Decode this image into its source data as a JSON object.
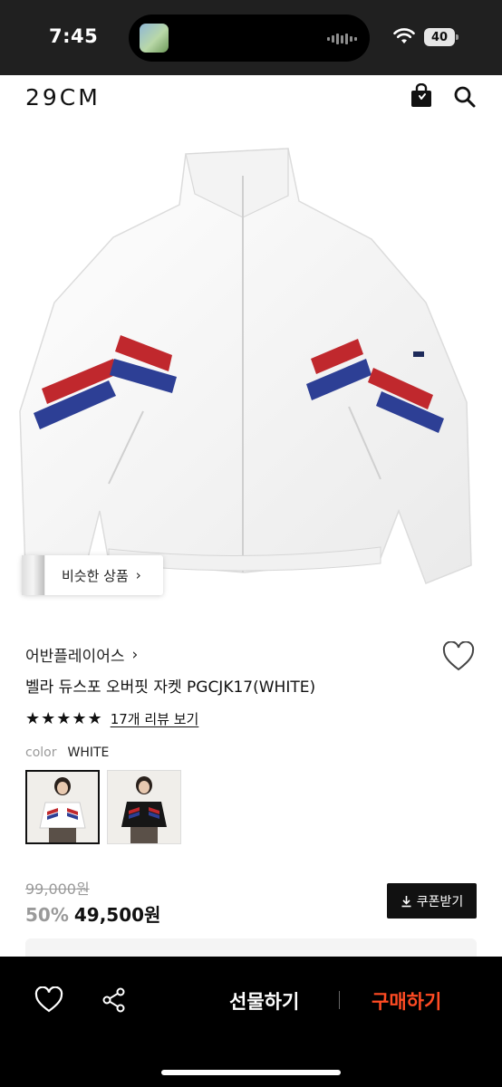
{
  "status_bar": {
    "time": "7:45",
    "battery": "40"
  },
  "header": {
    "logo": "29CM",
    "icons": [
      "bag-icon",
      "search-icon"
    ]
  },
  "product_image": {
    "similar_products_label": "비슷한 상품",
    "chevron": "›"
  },
  "product": {
    "brand": "어반플레이어스",
    "brand_chevron": "›",
    "name": "벨라 듀스포 오버핏 자켓 PGCJK17(WHITE)",
    "rating_stars": "★★★★★",
    "review_link": "17개 리뷰 보기",
    "color_label": "color",
    "color_value": "WHITE",
    "swatches": [
      {
        "color": "white",
        "selected": true
      },
      {
        "color": "black",
        "selected": false
      }
    ]
  },
  "price": {
    "original": "99,000원",
    "discount": "50%",
    "sale": "49,500원",
    "coupon_label": "쿠폰받기"
  },
  "bottom_bar": {
    "gift_label": "선물하기",
    "buy_label": "구매하기"
  },
  "colors": {
    "buy_accent": "#ff4b23",
    "status_bar": "#202020",
    "bottom_bar": "#000000"
  }
}
